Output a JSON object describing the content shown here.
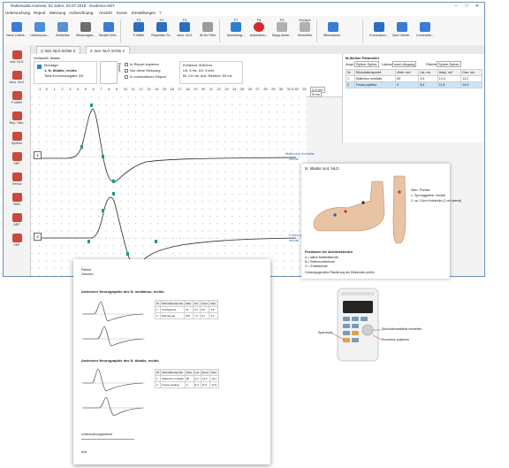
{
  "window": {
    "title": "Rattenwald Andreas, 54 Jahre, 03.07.2018 - Evidence.NET",
    "controls": [
      "–",
      "□",
      "✕"
    ]
  },
  "menu": [
    "Untersuchung",
    "Report",
    "Messung",
    "Aufzeichnung",
    "Ansicht",
    "Kurve",
    "Einstellungen",
    "?"
  ],
  "ribbon": {
    "buttons": [
      {
        "label": "Neue Unters...",
        "icon": "new-exam-icon",
        "color": "#3a7bd5"
      },
      {
        "label": "Untersuchu...",
        "icon": "exam-icon",
        "color": "#4a90d9"
      },
      {
        "label": "Schließen",
        "icon": "close-exam-icon",
        "color": "#5b8fd1"
      },
      {
        "label": "Messungsw...",
        "icon": "measure-icon",
        "color": "#6d6d6d"
      },
      {
        "label": "Bericht Wür...",
        "icon": "report-icon",
        "color": "#3a7bd5"
      },
      {
        "label": "F-Welle",
        "icon": "f-wave-icon",
        "color": "#2a6fbf",
        "fkey": "F2"
      },
      {
        "label": "Repetitive St...",
        "icon": "repetitive-stim-icon",
        "color": "#2a6fbf",
        "fkey": "F3"
      },
      {
        "label": "sens. NLG",
        "icon": "sensory-ncv-icon",
        "color": "#2a6fbf",
        "fkey": "F4"
      },
      {
        "label": "50 Hz Filter",
        "icon": "filter-icon",
        "color": "#9a9a9a",
        "fkey": ""
      },
      {
        "label": "Monitoring...",
        "icon": "play-icon",
        "color": "#2d7fd3",
        "fkey": "F7"
      },
      {
        "label": "Aufzeichnu...",
        "icon": "record-icon",
        "color": "#d62b2b",
        "fkey": "F8"
      },
      {
        "label": "Stopp Aufze...",
        "icon": "stop-icon",
        "color": "#b0b0b0",
        "fkey": "F9"
      },
      {
        "label": "Verwerfen",
        "icon": "discard-icon",
        "color": "#b0b0b0",
        "fkey": "Escape"
      },
      {
        "label": "Stimulatorei...",
        "icon": "stimulator-icon",
        "color": "#3a7bd5",
        "fkey": ""
      },
      {
        "label": "Kurvenkom...",
        "icon": "curve-compare-icon",
        "color": "#2a6fbf",
        "fkey": ""
      },
      {
        "label": "Zum Überbl...",
        "icon": "overview-icon",
        "color": "#3a7bd5",
        "fkey": ""
      },
      {
        "label": "Kurvenblä...",
        "icon": "curve-page-icon",
        "color": "#3a7bd5",
        "fkey": ""
      }
    ]
  },
  "sidebar": [
    {
      "label": "mot. NLG",
      "icon": "motor-ncv-icon",
      "color": "#c84a3a"
    },
    {
      "label": "sens. NLG",
      "icon": "sensory-ncv-icon",
      "color": "#c84a3a"
    },
    {
      "label": "F-Welle",
      "icon": "f-wave-icon",
      "color": "#c84a3a"
    },
    {
      "label": "Rep. Stim.",
      "icon": "rep-stim-icon",
      "color": "#c84a3a"
    },
    {
      "label": "Sporten",
      "icon": "sport-icon",
      "color": "#c84a3a"
    },
    {
      "label": "SEP",
      "icon": "sep-icon",
      "color": "#c84a3a"
    },
    {
      "label": "Tremor",
      "icon": "tremor-icon",
      "color": "#c84a3a"
    },
    {
      "label": "SMR",
      "icon": "smr-icon",
      "color": "#c84a3a"
    },
    {
      "label": "AEP",
      "icon": "aep-icon",
      "color": "#c84a3a"
    },
    {
      "label": "VEP",
      "icon": "vep-icon",
      "color": "#c84a3a"
    }
  ],
  "tabs": [
    "1: mot. NLG rechts",
    "2: mot. NLG rechts"
  ],
  "info": {
    "verlauf": "Verlaufsfl. tibialis",
    "montage_label": "Montage:",
    "montage_value": "1: N. tibialis, rechts",
    "kurvenausgabe": "Total Kurvenausgabe 2/9",
    "report_label": "Report",
    "checks": [
      "In Report kopieren",
      "Nur diese Messung",
      "In vorhandenen Report"
    ],
    "evidence": "Evidence 3182evo",
    "param1": "U0: 5 Hz, D0: 3 kHz",
    "param2": "Bl: 2.5 ms, Auc. Bereich: 50 ms"
  },
  "scale": {
    "ticks": [
      "-1",
      "0",
      "1",
      "2",
      "3",
      "4",
      "5",
      "6",
      "7",
      "8",
      "9",
      "10",
      "11",
      "12",
      "13",
      "14",
      "15",
      "16",
      "17",
      "18",
      "19",
      "20",
      "21",
      "22",
      "23",
      "24",
      "25",
      "26",
      "27",
      "28",
      "29",
      "30",
      "31,5",
      "32",
      "33"
    ],
    "sens": "2,5 mV",
    "time": "5 ms"
  },
  "traces": [
    {
      "row": "1",
      "label": "Malleolus medialis",
      "sub": "rechts"
    },
    {
      "row": "2",
      "label": "Fossa poplitea",
      "sub": "rechts"
    }
  ],
  "params": {
    "title": "M-Wellen Parameter",
    "controls": {
      "ampl": "Ampl.",
      "ampl_val": "Spitze-Spitze",
      "latenz": "Latenz",
      "latenz_val": "nach Abgang",
      "flaeche": "Fläche",
      "flaeche_val": "Spitze-Spitze"
    },
    "headers": [
      "Nr",
      "Stimulationspunkt",
      "Abst. mm",
      "Lat. ms",
      "Ampl. mV",
      "Dau. ms"
    ],
    "rows": [
      [
        "1",
        "Malleolus medialis",
        "80",
        "4,4",
        "14,3",
        "14,2"
      ],
      [
        "2",
        "Fossa poplitea",
        "0",
        "8,4",
        "11,6",
        "14,9"
      ]
    ]
  },
  "legs": {
    "title": "N. tibialis mot. NLG",
    "caption_title": "Stim. Punkte:",
    "caption": [
      "1. Sprunggelenk, medial",
      "2. ca. 10cm Kniekehle (1 cm lateral)"
    ],
    "footer_title": "Positionen der Ableitelektroden",
    "footer": [
      "A = aktive Ableitelektrode",
      "B = Referenzelektrode",
      "G = Erdelektrode"
    ],
    "note": "Ordnungsgemäße Platzierung der Elektroden prüfen"
  },
  "report": {
    "header": [
      "Patient:",
      "Geboren:"
    ],
    "sections": [
      {
        "title": "Anteriorer Neurographie des N. medianus, rechts",
        "headers": [
          "Nr",
          "Stimulationspunkt",
          "Abst.",
          "Lat.",
          "Ampl.",
          "Dau."
        ],
        "rows": [
          [
            "1",
            "Handgelenk",
            "70",
            "3,4",
            "8,6",
            "4,8"
          ],
          [
            "2",
            "Ellenbeuge",
            "225",
            "7,9",
            "8,1",
            "5,2"
          ]
        ]
      },
      {
        "title": "Anteriorer Neurographie des N. tibialis, rechts",
        "headers": [
          "Nr",
          "Stimulationspunkt",
          "Abst.",
          "Lat.",
          "Ampl.",
          "Dau."
        ],
        "rows": [
          [
            "1",
            "Malleolus medialis",
            "80",
            "4,4",
            "14,3",
            "14,2"
          ],
          [
            "2",
            "Fossa poplitea",
            "0",
            "8,4",
            "11,6",
            "14,9"
          ]
        ]
      }
    ],
    "footer": "Untersuchungsbefund",
    "sign": "Arzt"
  },
  "device": {
    "callouts": [
      "Speichern",
      "Stimulationsstärke einstellen",
      "Einzelreiz auslösen"
    ]
  }
}
